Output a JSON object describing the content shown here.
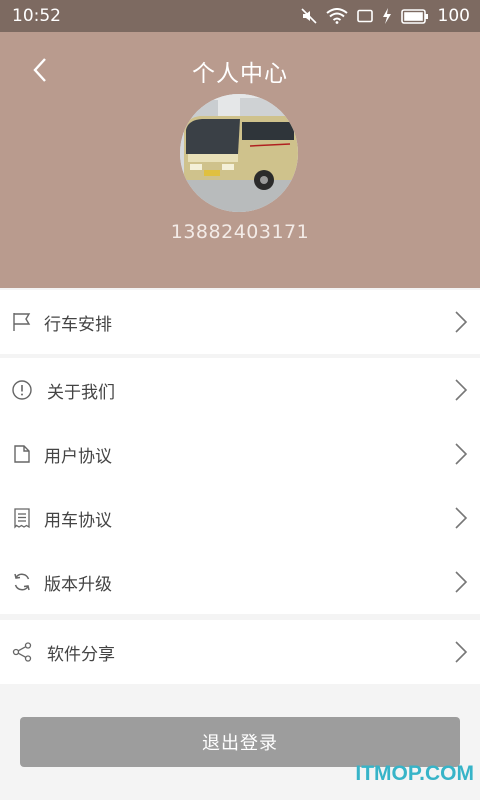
{
  "status_bar": {
    "time": "10:52",
    "battery": "100",
    "icons": [
      "mute-icon",
      "wifi-icon",
      "sim-icon",
      "charging-icon",
      "battery-icon"
    ]
  },
  "header": {
    "title": "个人中心",
    "phone": "13882403171",
    "background_color": "#b99b8e",
    "avatar": "bus-photo"
  },
  "menu_groups": [
    [
      {
        "label": "行车安排",
        "icon": "flag-icon"
      }
    ],
    [
      {
        "label": "关于我们",
        "icon": "info-icon"
      },
      {
        "label": "用户协议",
        "icon": "document-icon"
      },
      {
        "label": "用车协议",
        "icon": "receipt-icon"
      },
      {
        "label": "版本升级",
        "icon": "refresh-icon"
      }
    ],
    [
      {
        "label": "软件分享",
        "icon": "share-icon"
      }
    ]
  ],
  "logout_label": "退出登录",
  "watermark": "ITMOP.COM"
}
